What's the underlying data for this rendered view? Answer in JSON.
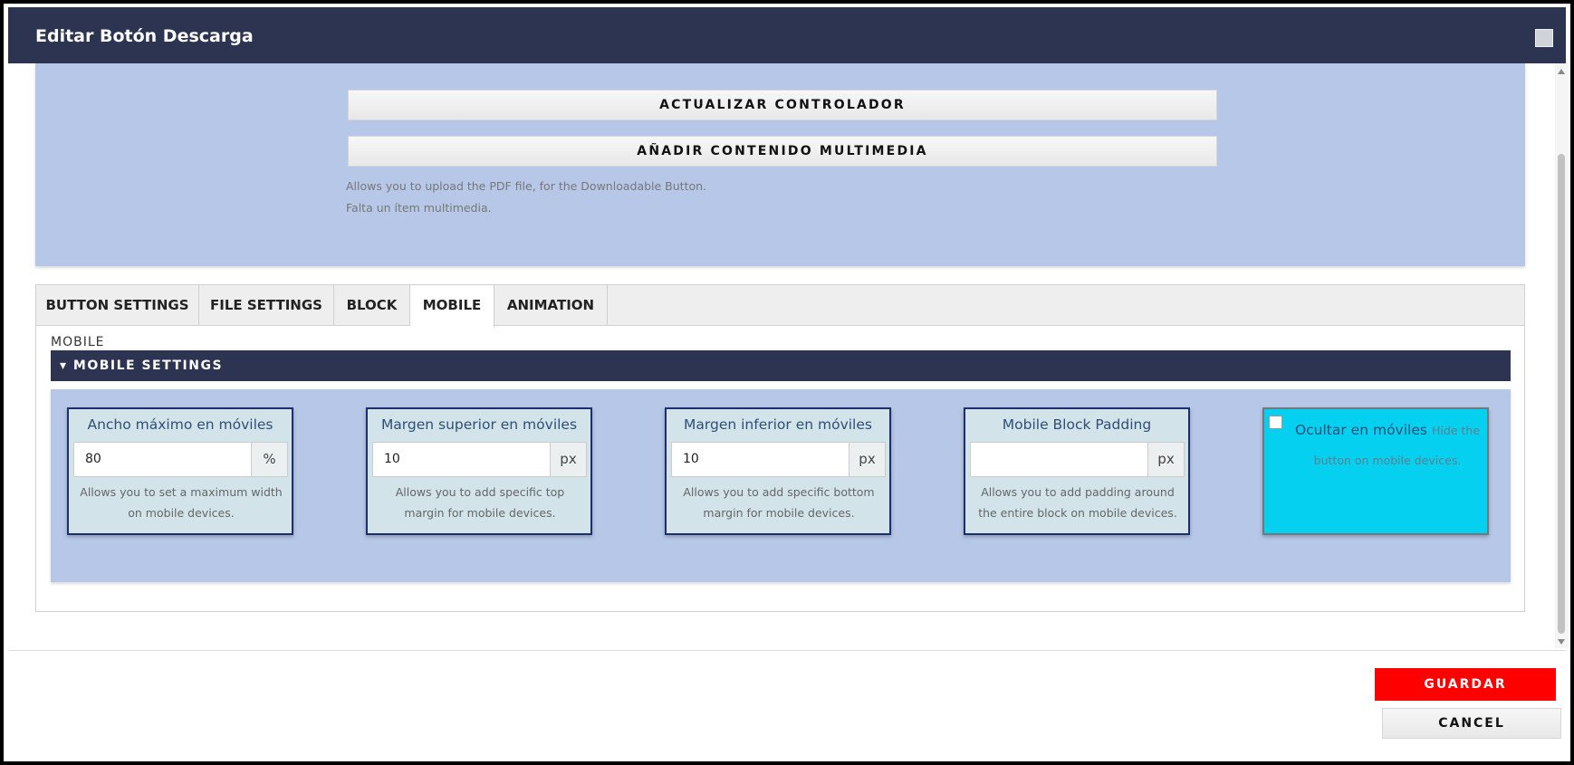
{
  "dialog": {
    "title": "Editar Botón Descarga",
    "close_icon": "close-icon"
  },
  "upload": {
    "update_button": "ACTUALIZAR CONTROLADOR",
    "add_media_button": "AÑADIR CONTENIDO MULTIMEDIA",
    "help_text": "Allows you to upload the PDF file, for the Downloadable Button.",
    "missing_text": "Falta un ítem multimedia."
  },
  "tabs": [
    {
      "label": "BUTTON SETTINGS"
    },
    {
      "label": "FILE SETTINGS"
    },
    {
      "label": "BLOCK"
    },
    {
      "label": "MOBILE"
    },
    {
      "label": "ANIMATION"
    }
  ],
  "active_tab": "MOBILE",
  "mobile": {
    "section_label": "MOBILE",
    "accordion_title": "▾ MOBILE SETTINGS",
    "fields": [
      {
        "label": "Ancho máximo en móviles",
        "value": "80",
        "unit": "%",
        "desc": "Allows you to set a maximum width on mobile devices."
      },
      {
        "label": "Margen superior en móviles",
        "value": "10",
        "unit": "px",
        "desc": "Allows you to add specific top margin for mobile devices."
      },
      {
        "label": "Margen inferior en móviles",
        "value": "10",
        "unit": "px",
        "desc": "Allows you to add specific bottom margin for mobile devices."
      },
      {
        "label": "Mobile Block Padding",
        "value": "",
        "unit": "px",
        "desc": "Allows you to add padding around the entire block on mobile devices."
      }
    ],
    "hide": {
      "label": "Ocultar en móviles",
      "desc": "Hide the button on mobile devices."
    }
  },
  "footer": {
    "save_label": "GUARDAR",
    "cancel_label": "CANCEL"
  },
  "colors": {
    "header": "#2d3452",
    "panel": "#b7c7e7",
    "card": "#d2e3ea",
    "hide_card": "#05d0f0",
    "save": "#ff0000"
  }
}
